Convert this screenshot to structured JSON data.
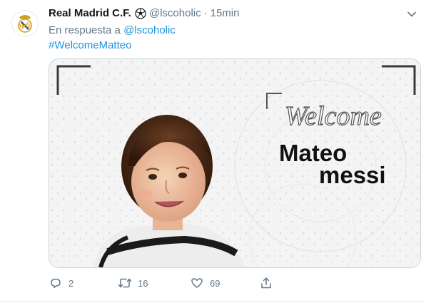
{
  "tweet": {
    "display_name": "Real Madrid C.F.",
    "handle": "@lscoholic",
    "separator": "·",
    "time": "15min",
    "reply_prefix": "En respuesta a",
    "reply_to": "@lscoholic",
    "hashtag": "#WelcomeMatteo",
    "icons": {
      "avatar": "real-madrid-crest",
      "badge": "soccer-ball",
      "menu": "chevron-down"
    }
  },
  "media": {
    "welcome_text": "Welcome",
    "name_line1": "Mateo",
    "name_line2": "messi"
  },
  "actions": {
    "replies": "2",
    "retweets": "16",
    "likes": "69",
    "icons": [
      "reply",
      "retweet",
      "like",
      "share"
    ]
  },
  "colors": {
    "link": "#1b95e0",
    "muted": "#657786",
    "text": "#14171a"
  }
}
